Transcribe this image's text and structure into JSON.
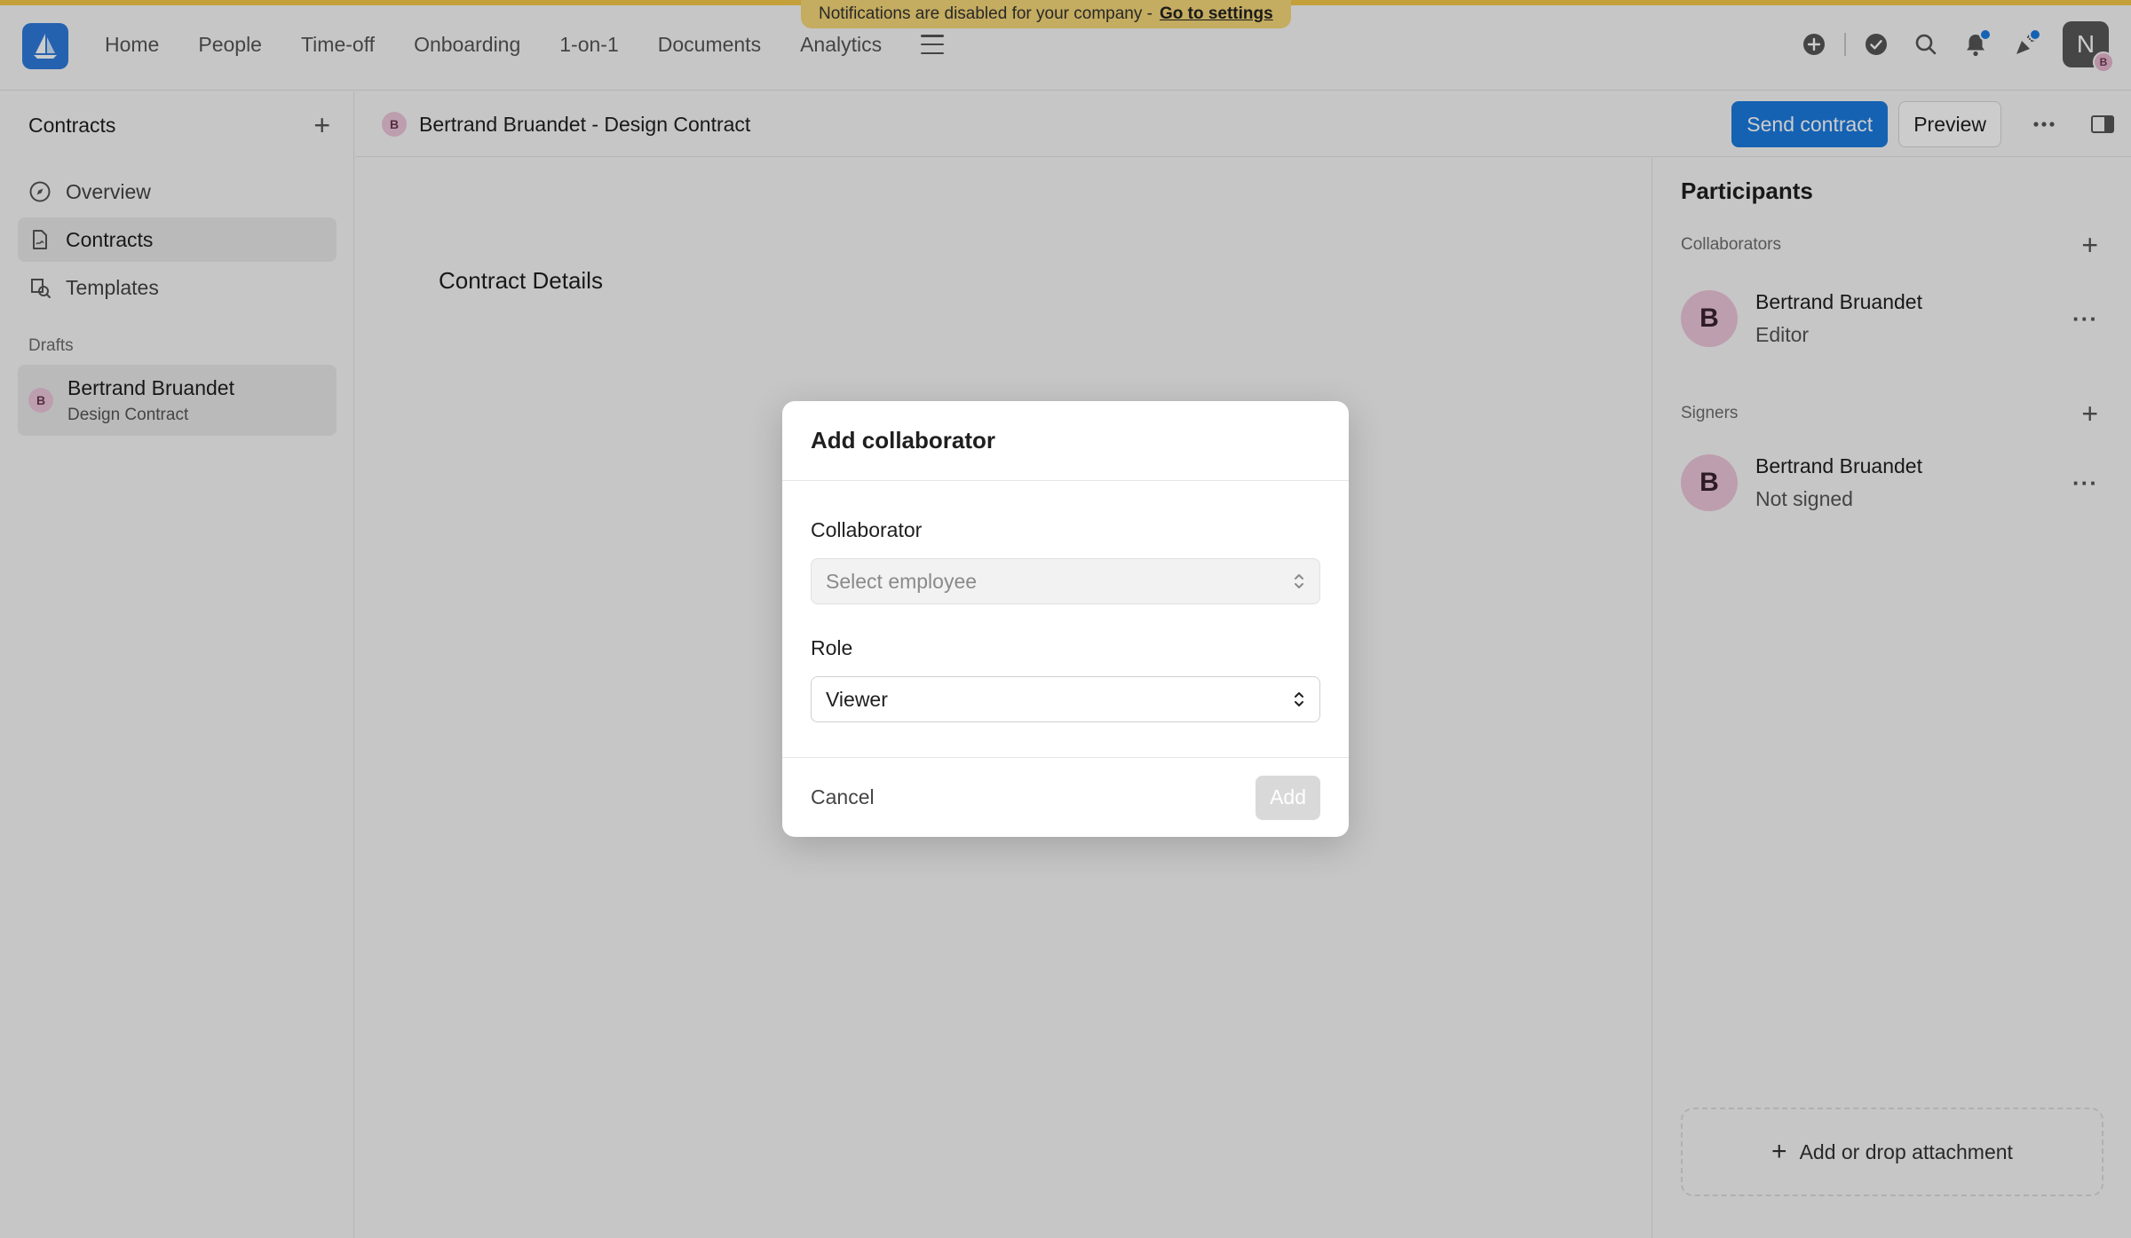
{
  "nav": {
    "items": [
      {
        "label": "Home"
      },
      {
        "label": "People"
      },
      {
        "label": "Time-off"
      },
      {
        "label": "Onboarding"
      },
      {
        "label": "1-on-1"
      },
      {
        "label": "Documents"
      },
      {
        "label": "Analytics"
      }
    ],
    "avatar_letter": "N",
    "avatar_badge": "B"
  },
  "banner": {
    "text": "Notifications are disabled for your company -",
    "link": "Go to settings"
  },
  "sidebar": {
    "title": "Contracts",
    "items": [
      {
        "label": "Overview",
        "icon": "compass-icon"
      },
      {
        "label": "Contracts",
        "icon": "document-icon"
      },
      {
        "label": "Templates",
        "icon": "templates-icon"
      }
    ],
    "section_label": "Drafts",
    "draft": {
      "initial": "B",
      "name": "Bertrand Bruandet",
      "subtitle": "Design Contract"
    }
  },
  "header": {
    "initial": "B",
    "title": "Bertrand Bruandet - Design Contract",
    "send_label": "Send contract",
    "preview_label": "Preview"
  },
  "main": {
    "section_title": "Contract Details"
  },
  "participants": {
    "title": "Participants",
    "collaborators_label": "Collaborators",
    "signers_label": "Signers",
    "collaborator": {
      "initial": "B",
      "name": "Bertrand Bruandet",
      "role": "Editor"
    },
    "signer": {
      "initial": "B",
      "name": "Bertrand Bruandet",
      "status": "Not signed"
    },
    "attachment_label": "Add or drop attachment"
  },
  "modal": {
    "title": "Add collaborator",
    "collaborator_label": "Collaborator",
    "collaborator_placeholder": "Select employee",
    "role_label": "Role",
    "role_value": "Viewer",
    "cancel_label": "Cancel",
    "add_label": "Add"
  },
  "colors": {
    "accent": "#1b7be0",
    "banner": "#f6d779",
    "avatar_pink": "#edc6da"
  }
}
